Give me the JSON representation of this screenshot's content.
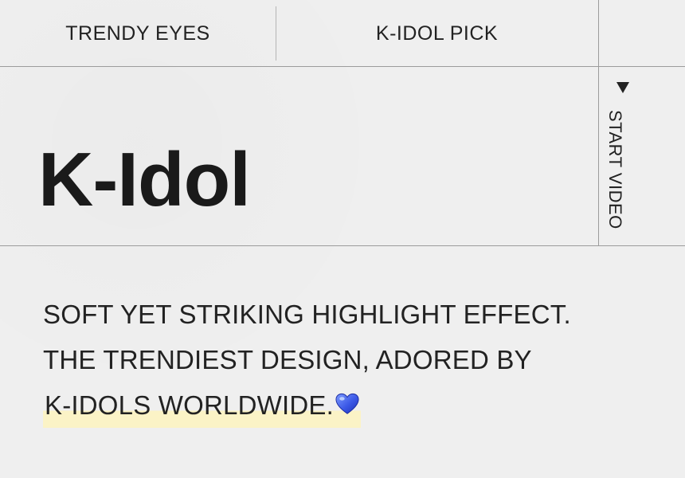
{
  "nav": {
    "tabs": [
      {
        "label": "TRENDY EYES"
      },
      {
        "label": "K-IDOL PICK"
      }
    ]
  },
  "hero": {
    "title": "K-Idol"
  },
  "video_control": {
    "label": "START VIDEO",
    "icon": "play-down-triangle-icon"
  },
  "description": {
    "lines": [
      "SOFT YET STRIKING HIGHLIGHT EFFECT.",
      "THE TRENDIEST DESIGN, ADORED BY",
      "K-IDOLS WORLDWIDE."
    ],
    "emoji_icon": "blue-heart-icon"
  },
  "colors": {
    "background": "#efefef",
    "text": "#1f1f1f",
    "divider": "#9c9c9c",
    "highlight": "#fbf3c6",
    "heart": "#3b58e6"
  }
}
